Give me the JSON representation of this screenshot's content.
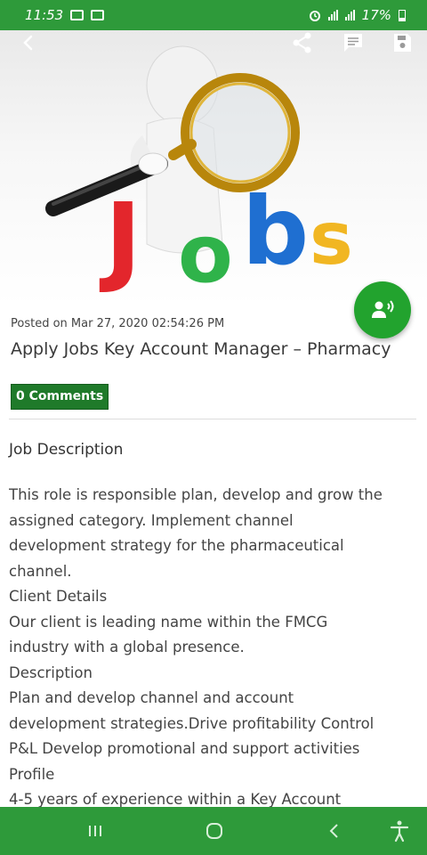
{
  "status_bar": {
    "time": "11:53",
    "battery": "17%",
    "left_icons": [
      "image-icon",
      "cast-icon"
    ],
    "right_icons": [
      "alarm-icon",
      "signal-icon",
      "data-signal-icon",
      "battery-icon"
    ]
  },
  "app_bar": {
    "icons": [
      "back-icon",
      "share-icon",
      "comment-icon",
      "save-icon"
    ]
  },
  "hero": {
    "image": "magnifying-glass-figure-jobs-illustration",
    "word": "Jobs"
  },
  "fab": {
    "icon": "speaker-icon"
  },
  "post": {
    "posted": "Posted on Mar 27, 2020 02:54:26 PM",
    "title": "Apply Jobs Key Account Manager – Pharmacy",
    "comments_label": "0 Comments"
  },
  "section": {
    "title": "Job Description",
    "lines": [
      "This role is responsible plan, develop and grow the",
      "assigned category. Implement channel",
      "development strategy for the pharmaceutical",
      "channel.",
      "Client Details",
      "Our client is leading name within the FMCG",
      "industry with a global presence.",
      "Description",
      "Plan and develop channel and account",
      "development strategies.Drive profitability Control",
      "P&L Develop promotional and support activities",
      "Profile",
      "4-5 years of experience within a Key Account"
    ]
  },
  "nav_bar": {
    "icons": [
      "recent-apps-icon",
      "home-icon",
      "back-nav-icon",
      "accessibility-icon"
    ]
  },
  "colors": {
    "status_green": "#2e9a3a",
    "comments_badge": "#1f7a2a",
    "fab": "#22a32e"
  }
}
